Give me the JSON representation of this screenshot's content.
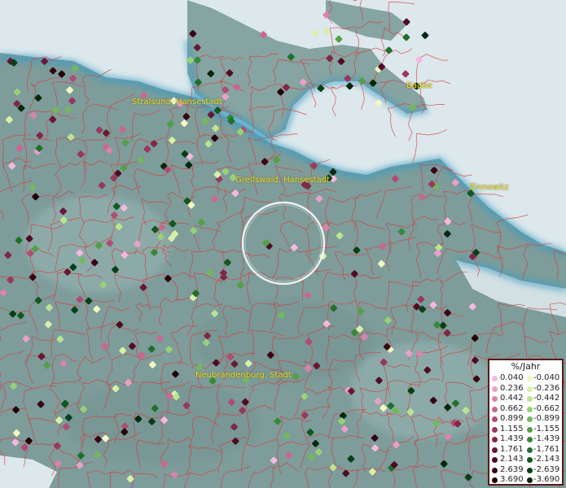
{
  "map": {
    "places": [
      {
        "name": "Stralsund, Hansestadt",
        "key": "stralsund"
      },
      {
        "name": "Baabe",
        "key": "baabe"
      },
      {
        "name": "Greifswald, Hansestadt",
        "key": "greifswald"
      },
      {
        "name": "Zinnowitz",
        "key": "zinnowitz"
      },
      {
        "name": "Neubrandenburg, Stadt",
        "key": "neubrandenburg"
      }
    ]
  },
  "legend": {
    "title": "%/Jahr",
    "positive": [
      {
        "label": "0.040",
        "color": "#f4b8e0"
      },
      {
        "label": "0.236",
        "color": "#e8a0c8"
      },
      {
        "label": "0.442",
        "color": "#d884ac"
      },
      {
        "label": "0.662",
        "color": "#c86890"
      },
      {
        "label": "0.899",
        "color": "#b04c74"
      },
      {
        "label": "1.155",
        "color": "#98385c"
      },
      {
        "label": "1.439",
        "color": "#802848"
      },
      {
        "label": "1.761",
        "color": "#681834"
      },
      {
        "label": "2.143",
        "color": "#500c24"
      },
      {
        "label": "2.639",
        "color": "#380414"
      },
      {
        "label": "3.690",
        "color": "#220008"
      }
    ],
    "negative": [
      {
        "label": "-0.040",
        "color": "#f0f8c0"
      },
      {
        "label": "-0.236",
        "color": "#d8f0a8"
      },
      {
        "label": "-0.442",
        "color": "#bce490"
      },
      {
        "label": "-0.662",
        "color": "#98d078"
      },
      {
        "label": "-0.899",
        "color": "#74b85c"
      },
      {
        "label": "-1.155",
        "color": "#52a048"
      },
      {
        "label": "-1.439",
        "color": "#368838"
      },
      {
        "label": "-1.761",
        "color": "#20702c"
      },
      {
        "label": "-2.143",
        "color": "#105820"
      },
      {
        "label": "-2.639",
        "color": "#064016"
      },
      {
        "label": "-3.690",
        "color": "#02280c"
      }
    ]
  }
}
